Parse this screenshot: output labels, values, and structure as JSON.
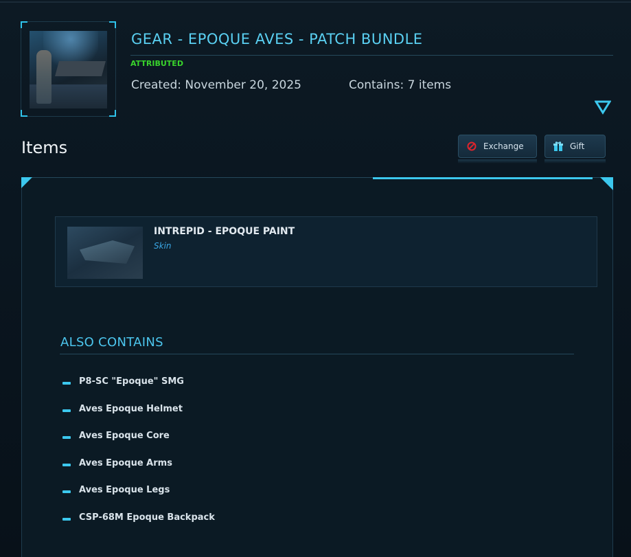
{
  "bundle": {
    "title": "GEAR - EPOQUE AVES - PATCH BUNDLE",
    "status": "ATTRIBUTED",
    "created": "Created: November 20, 2025",
    "contains": "Contains: 7 items"
  },
  "items_section": {
    "heading": "Items",
    "exchange_label": "Exchange",
    "gift_label": "Gift"
  },
  "main_item": {
    "name": "INTREPID - EPOQUE PAINT",
    "type": "Skin"
  },
  "also_contains": {
    "heading": "ALSO CONTAINS",
    "items": [
      "P8-SC \"Epoque\" SMG",
      "Aves Epoque Helmet",
      "Aves Epoque Core",
      "Aves Epoque Arms",
      "Aves Epoque Legs",
      "CSP-68M Epoque Backpack"
    ]
  },
  "colors": {
    "accent": "#3cc8ee",
    "title": "#5ad0f2",
    "attributed": "#39d42c",
    "exchange_icon": "#e0242c"
  },
  "icons": {
    "expand": "chevron-down-icon",
    "exchange": "no-entry-icon",
    "gift": "gift-icon"
  }
}
